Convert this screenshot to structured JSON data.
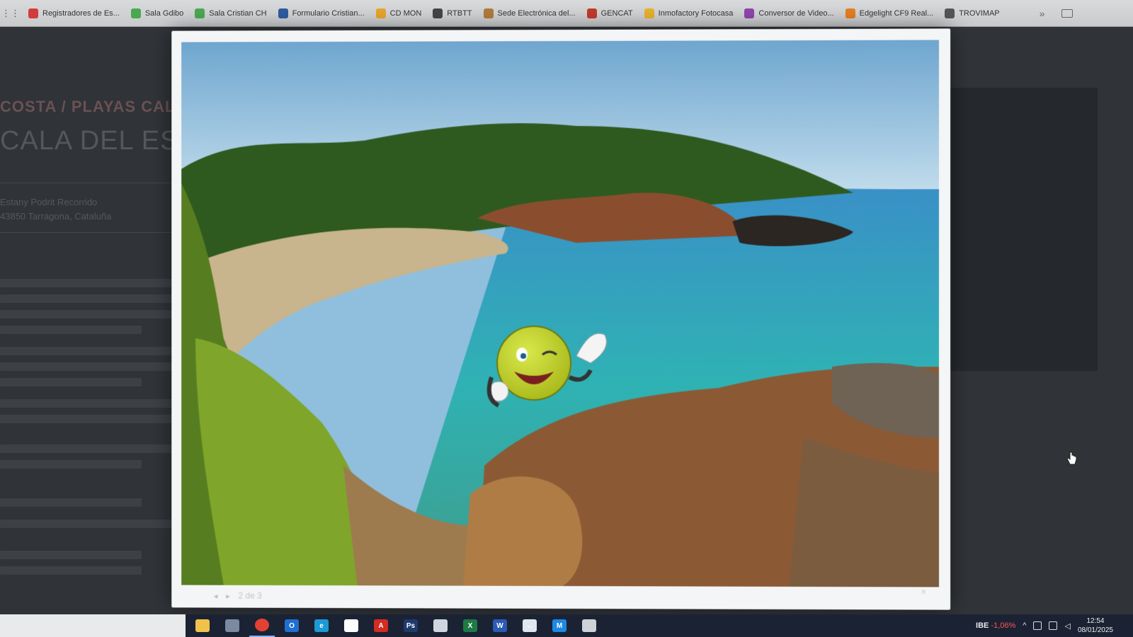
{
  "bookmarks": {
    "items": [
      {
        "label": "Registradores de Es...",
        "color": "#d33b3b"
      },
      {
        "label": "Sala Gdibo",
        "color": "#4aa84f"
      },
      {
        "label": "Sala Cristian CH",
        "color": "#4aa84f"
      },
      {
        "label": "Formulario Cristian...",
        "color": "#2c5aa0"
      },
      {
        "label": "CD MON",
        "color": "#e7a42b"
      },
      {
        "label": "RTBTT",
        "color": "#444444"
      },
      {
        "label": "Sede Electrónica del...",
        "color": "#b07a3a"
      },
      {
        "label": "GENCAT",
        "color": "#c0392b"
      },
      {
        "label": "Inmofactory Fotocasa",
        "color": "#e8b12a"
      },
      {
        "label": "Conversor de Video...",
        "color": "#8e44ad"
      },
      {
        "label": "Edgelight CF9 Real...",
        "color": "#e67e22"
      },
      {
        "label": "TROVIMAP",
        "color": "#555555"
      }
    ],
    "more": "»"
  },
  "background_page": {
    "breadcrumb": "COSTA / PLAYAS CALAS",
    "title": "CALA DEL ESTANY",
    "address_line1": "Estany Podrit Recorrido",
    "address_line2": "43850 Tarragona, Cataluña"
  },
  "lightbox": {
    "counter": "2 de 3",
    "prev": "◂",
    "next": "▸",
    "close": "×"
  },
  "taskbar": {
    "apps": [
      {
        "name": "file-explorer",
        "color": "#f0c24b",
        "glyph": ""
      },
      {
        "name": "store",
        "color": "#7a8aa0",
        "glyph": ""
      },
      {
        "name": "chrome",
        "color": "#e34133",
        "glyph": ""
      },
      {
        "name": "outlook",
        "color": "#1f6fd1",
        "glyph": "O"
      },
      {
        "name": "edge",
        "color": "#1a9ad6",
        "glyph": "e"
      },
      {
        "name": "acrobat",
        "color": "#ffffff",
        "glyph": ""
      },
      {
        "name": "acrobat-pro",
        "color": "#d42b22",
        "glyph": "A"
      },
      {
        "name": "photoshop",
        "color": "#1f3b6e",
        "glyph": "Ps"
      },
      {
        "name": "paint",
        "color": "#cfd6df",
        "glyph": ""
      },
      {
        "name": "excel",
        "color": "#1e7a44",
        "glyph": "X"
      },
      {
        "name": "word",
        "color": "#2b5bb7",
        "glyph": "W"
      },
      {
        "name": "teamviewer",
        "color": "#e0e6ef",
        "glyph": "↔"
      },
      {
        "name": "movistar",
        "color": "#1e88e5",
        "glyph": "M"
      },
      {
        "name": "app-generic",
        "color": "#cfd2d6",
        "glyph": ""
      }
    ],
    "tray": {
      "ticker": "IBE",
      "change": "-1,06%",
      "time": "12:54",
      "date": "08/01/2025"
    }
  }
}
